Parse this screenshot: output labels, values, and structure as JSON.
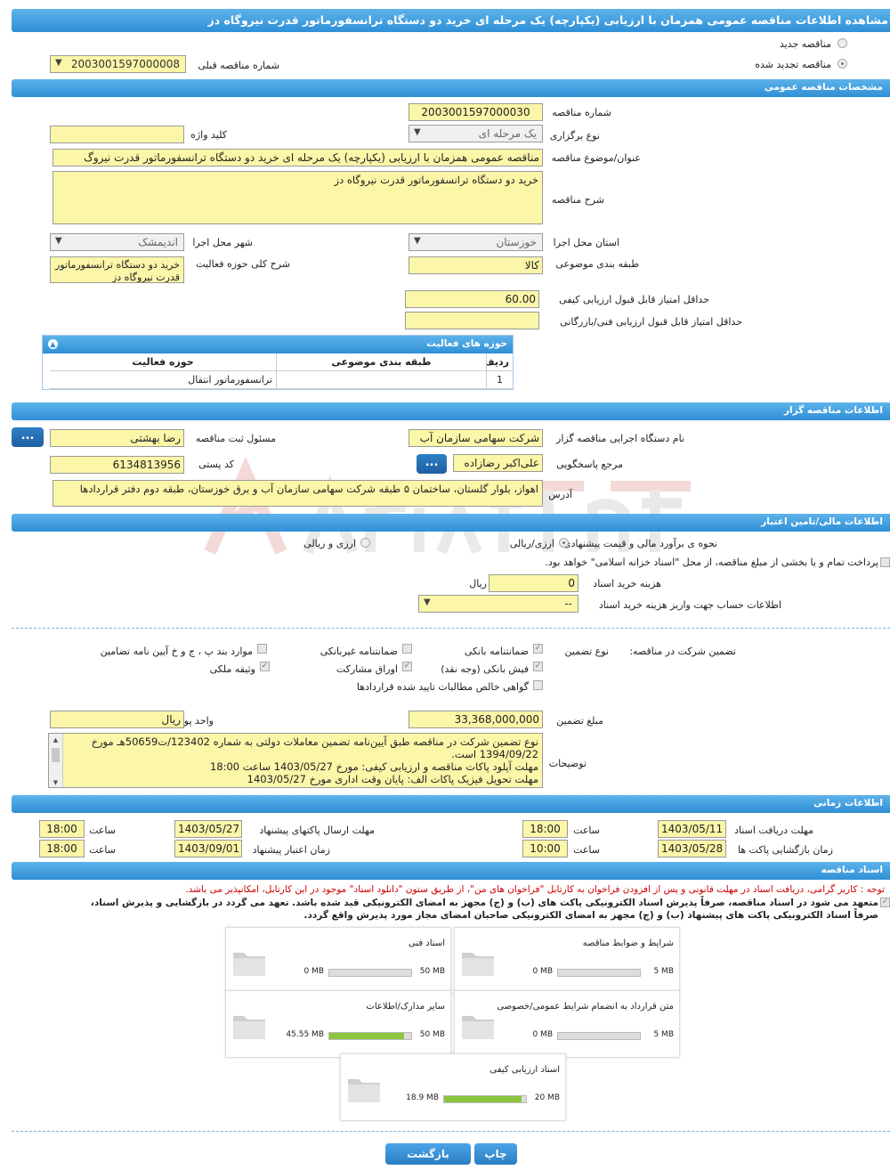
{
  "title": "مشاهده اطلاعات مناقصه عمومی همزمان با ارزیابی (یکپارچه) یک مرحله ای خرید دو دستگاه ترانسفورماتور قدرت نیروگاه دز",
  "top": {
    "new_label": "مناقصه جدید",
    "renewed_label": "مناقصه تجدید شده",
    "prev_number_label": "شماره مناقصه قبلی",
    "prev_number_value": "2003001597000008"
  },
  "general": {
    "header": "مشخصات مناقصه عمومی",
    "number_label": "شماره مناقصه",
    "number_value": "2003001597000030",
    "type_label": "نوع برگزاری",
    "type_value": "یک مرحله ای",
    "keyword_label": "کلید واژه",
    "keyword_value": "",
    "subject_label": "عنوان/موضوع مناقصه",
    "subject_value": "مناقصه عمومی همزمان با ارزیابی (یکپارچه) یک مرحله ای خرید دو دستگاه ترانسفورماتور قدرت نیروگ",
    "desc_label": "شرح مناقصه",
    "desc_value": "خرید دو دستگاه ترانسفورماتور قدرت نیروگاه دز",
    "province_label": "استان محل اجرا",
    "province_value": "خوزستان",
    "city_label": "شهر محل اجرا",
    "city_value": "اندیمشک",
    "category_label": "طبقه بندی موضوعی",
    "category_value": "کالا",
    "scope_label": "شرح کلی حوزه فعالیت",
    "scope_value": "خرید دو دستگاه ترانسفورماتور قدرت نیروگاه دز",
    "min_quality_label": "حداقل امتیاز قابل قبول ارزیابی کیفی",
    "min_quality_value": "60.00",
    "min_tech_label": "حداقل امتیاز قابل قبول ارزیابی فنی/بازرگانی",
    "min_tech_value": ""
  },
  "activity": {
    "header": "حوزه های فعالیت",
    "col_row": "ردیف",
    "col_cat": "طبقه بندی موضوعی",
    "col_field": "حوزه فعالیت",
    "rows": [
      {
        "row": "1",
        "cat": "",
        "field": "ترانسفورماتور انتقال"
      }
    ]
  },
  "organizer": {
    "header": "اطلاعات مناقصه گزار",
    "org_label": "نام دستگاه اجرایی مناقصه گزار",
    "org_value": "شرکت سهامی سازمان آب",
    "registrar_label": "مسئول ثبت مناقصه",
    "registrar_value": "رضا بهشتی",
    "ref_label": "مرجع پاسخگویی",
    "ref_value": "علی‌اکبر رضازاده",
    "postal_label": "کد پستی",
    "postal_value": "6134813956",
    "address_label": "آدرس",
    "address_value": "اهواز، بلوار گلستان، ساختمان ۵ طبقه شرکت سهامی سازمان آب و برق خوزستان، طبقه دوم دفتر قراردادها",
    "dots": "..."
  },
  "finance": {
    "header": "اطلاعات مالی/تامین اعتبار",
    "estimate_label": "نحوه ی برآورد مالی و قیمت پیشنهادی",
    "opt1": "ارزی/ریالی",
    "opt2": "ارزی و ریالی",
    "payment_label": "پرداخت تمام و یا بخشی از مبلغ مناقصه، از محل \"اسناد خزانه اسلامی\" خواهد بود.",
    "fee_label": "هزینه خرید اسناد",
    "fee_value": "0",
    "fee_unit": "ریال",
    "account_label": "اطلاعات حساب جهت واریز هزینه خرید اسناد",
    "account_value": "--"
  },
  "guarantee": {
    "label": "تضمین شرکت در مناقصه:",
    "type_label": "نوع تضمین",
    "items": [
      "ضمانتنامه بانکی",
      "ضمانتنامه غیربانکی",
      "موارد بند پ ، ج و خ آیین نامه تضامین",
      "فیش بانکی (وجه نقد)",
      "اوراق مشارکت",
      "وثیقه ملکی",
      "گواهی خالص مطالبات تایید شده قراردادها"
    ],
    "amount_label": "مبلغ تضمین",
    "amount_value": "33,368,000,000",
    "currency_label": "واحد پول",
    "currency_value": "ریال",
    "desc_label": "توضیحات",
    "desc_lines": [
      "نوع تضمین شرکت در مناقصه طبق آیین‌نامه تضمین معاملات دولتی به شماره 123402/ت50659هـ مورخ",
      "1394/09/22 است.",
      "مهلت آپلود پاکات مناقصه و ارزیابی کیفی: مورخ 1403/05/27 ساعت 18:00",
      "مهلت تحویل فیزیک پاکات الف: پایان وقت اداری مورخ 1403/05/27"
    ]
  },
  "timing": {
    "header": "اطلاعات زمانی",
    "doc_deadline_label": "مهلت دریافت اسناد",
    "doc_deadline_date": "1403/05/11",
    "doc_deadline_time": "18:00",
    "send_deadline_label": "مهلت ارسال پاکتهای پیشنهاد",
    "send_deadline_date": "1403/05/27",
    "send_deadline_time": "18:00",
    "open_label": "زمان بازگشایی پاکت ها",
    "open_date": "1403/05/28",
    "open_time": "10:00",
    "validity_label": "زمان اعتبار پیشنهاد",
    "validity_date": "1403/09/01",
    "validity_time": "18:00",
    "time_label": "ساعت"
  },
  "docs": {
    "header": "اسناد مناقصه",
    "notice": "توجه : کاربر گرامی، دریافت اسناد در مهلت قانونی و پس از افزودن فراخوان به کارتابل \"فراخوان های من\"، از طریق ستون \"دانلود اسناد\" موجود در این کارتابل، امکانپذیر می باشد.",
    "commit1": "متعهد می شود در اسناد مناقصه، صرفاً پذیرش اسناد الکترونیکی پاکت های (ب) و (ج) مجهز به امضای الکترونیکی قید شده باشد. تعهد می گردد در بازگشایی و پذیرش اسناد،",
    "commit2": "صرفاً اسناد الکترونیکی پاکت های پیشنهاد (ب) و (ج) مجهز به امضای الکترونیکی صاحبان امضای مجاز مورد پذیرش واقع گردد.",
    "cards": [
      {
        "title": "شرایط و ضوابط مناقصه",
        "max": "5 MB",
        "cur": "0 MB",
        "pct": 0
      },
      {
        "title": "اسناد فنی",
        "max": "50 MB",
        "cur": "0 MB",
        "pct": 0
      },
      {
        "title": "متن قرارداد به انضمام شرایط عمومی/خصوصی",
        "max": "5 MB",
        "cur": "0 MB",
        "pct": 0
      },
      {
        "title": "سایر مدارک/اطلاعات",
        "max": "50 MB",
        "cur": "45.55 MB",
        "pct": 0.91
      },
      {
        "title": "اسناد ارزیابی کیفی",
        "max": "20 MB",
        "cur": "18.9 MB",
        "pct": 0.945
      }
    ]
  },
  "buttons": {
    "print": "چاپ",
    "back": "بازگشت"
  },
  "colors": {
    "accent": "#2f8fd6",
    "input_bg": "#fbf6a8",
    "progress": "#8cc63f",
    "notice": "#d00000"
  }
}
